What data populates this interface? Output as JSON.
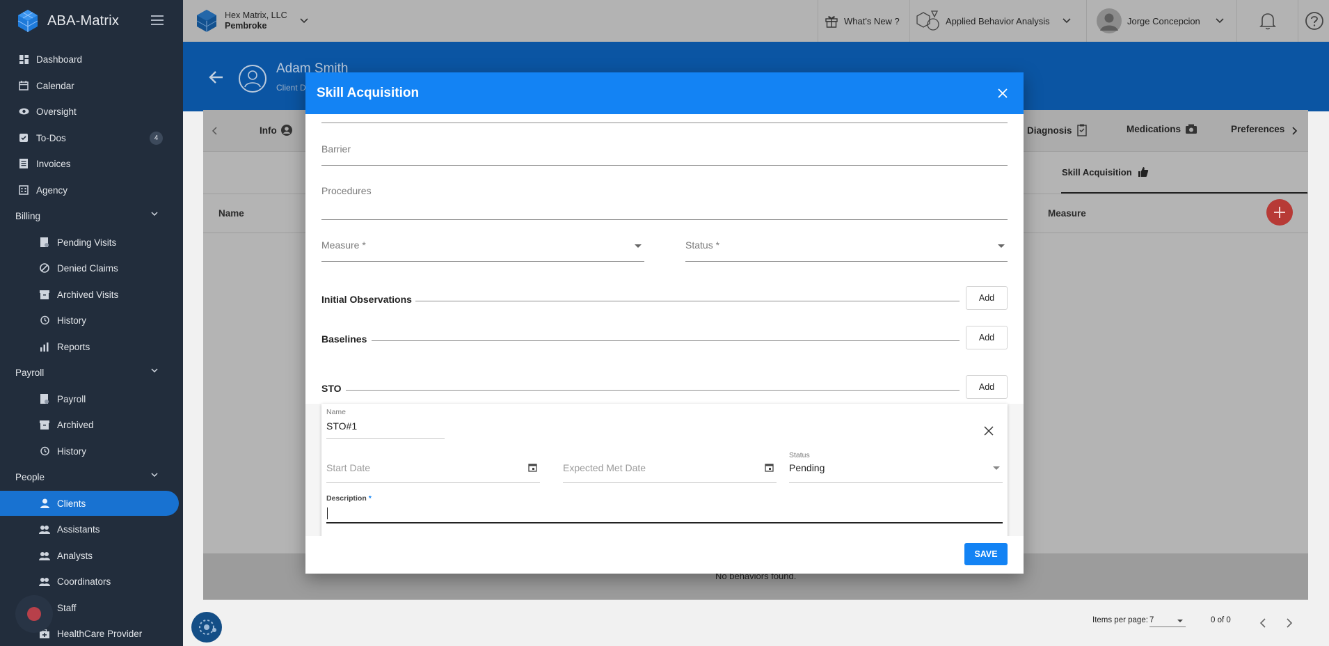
{
  "app": {
    "name": "ABA-Matrix"
  },
  "org": {
    "company": "Hex Matrix, LLC",
    "location": "Pembroke"
  },
  "topbar": {
    "whats_new": "What's New ?",
    "module": "Applied Behavior Analysis",
    "user": "Jorge Concepcion"
  },
  "sidebar": {
    "items": [
      {
        "label": "Dashboard"
      },
      {
        "label": "Calendar"
      },
      {
        "label": "Oversight"
      },
      {
        "label": "To-Dos",
        "badge": "4"
      },
      {
        "label": "Invoices"
      },
      {
        "label": "Agency"
      }
    ],
    "billing": {
      "label": "Billing",
      "items": [
        "Pending Visits",
        "Denied Claims",
        "Archived Visits",
        "History",
        "Reports"
      ]
    },
    "payroll": {
      "label": "Payroll",
      "items": [
        "Payroll",
        "Archived",
        "History"
      ]
    },
    "people": {
      "label": "People",
      "items": [
        "Clients",
        "Assistants",
        "Analysts",
        "Coordinators",
        "Staff",
        "HealthCare Provider"
      ]
    }
  },
  "client": {
    "name": "Adam Smith",
    "subtitle": "Client D"
  },
  "tabs": [
    "Info",
    "Diagnosis",
    "Medications",
    "Preferences"
  ],
  "subtab": "Skill Acquisition",
  "table": {
    "col_name": "Name",
    "col_measure": "Measure",
    "empty": "No behaviors found."
  },
  "paginator": {
    "items_per_page_label": "Items per page:",
    "items_per_page": "7",
    "range": "0 of 0"
  },
  "modal": {
    "title": "Skill Acquisition",
    "barrier_placeholder": "Barrier",
    "procedures_placeholder": "Procedures",
    "measure_placeholder": "Measure *",
    "status_placeholder": "Status *",
    "initial_observations": "Initial Observations",
    "baselines": "Baselines",
    "sto": "STO",
    "add_label": "Add",
    "sto_item": {
      "name_label": "Name",
      "name_value": "STO#1",
      "start_date_placeholder": "Start Date",
      "expected_met_placeholder": "Expected Met Date",
      "status_label": "Status",
      "status_value": "Pending",
      "description_label": "Description",
      "description_required": "*"
    },
    "save_label": "SAVE"
  }
}
